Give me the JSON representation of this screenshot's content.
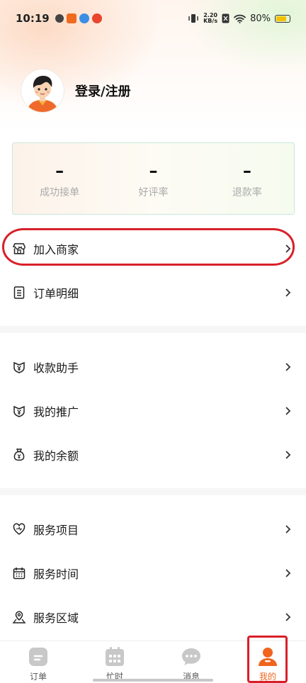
{
  "status_bar": {
    "time": "10:19",
    "net_speed_value": "2.20",
    "net_speed_unit": "KB/s",
    "battery": "80%",
    "battery_level": 0.8
  },
  "profile": {
    "login_label": "登录/注册"
  },
  "stats": [
    {
      "value": "–",
      "label": "成功接单"
    },
    {
      "value": "–",
      "label": "好评率"
    },
    {
      "value": "–",
      "label": "退款率"
    }
  ],
  "menu": {
    "join_merchant": "加入商家",
    "order_detail": "订单明细",
    "payment_assistant": "收款助手",
    "my_promotion": "我的推广",
    "my_balance": "我的余额",
    "service_items": "服务项目",
    "service_time": "服务时间",
    "service_area": "服务区域"
  },
  "tabs": [
    {
      "label": "订单"
    },
    {
      "label": "忙时"
    },
    {
      "label": "消息"
    },
    {
      "label": "我的"
    }
  ],
  "colors": {
    "accent": "#f0641e",
    "highlight": "#d8202a",
    "icon_gray": "#c8c8c8"
  }
}
